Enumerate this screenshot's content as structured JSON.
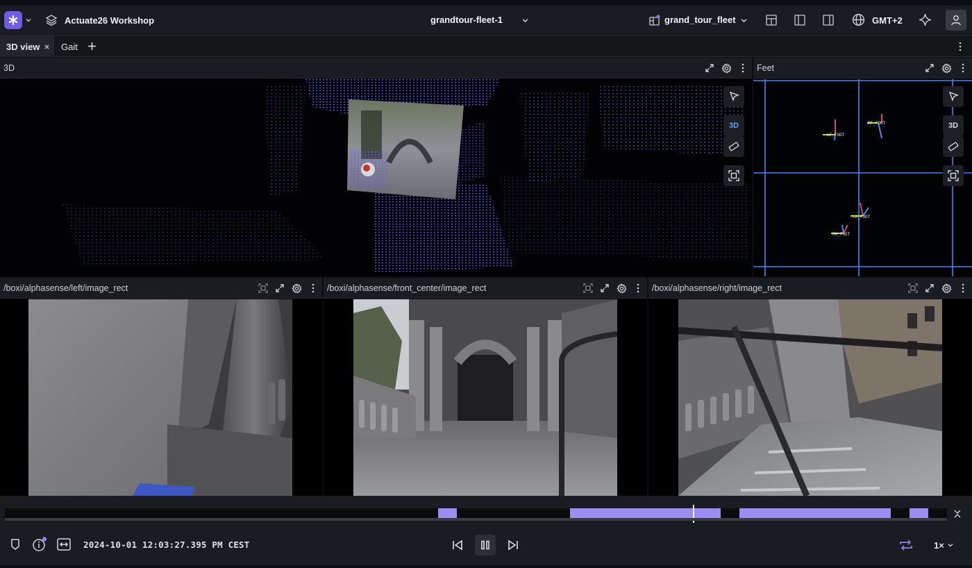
{
  "topbar": {
    "workspace": "Actuate26 Workshop",
    "session": "grandtour-fleet-1",
    "layout": "grand_tour_fleet",
    "timezone": "GMT+2"
  },
  "tabs": [
    {
      "label": "3D view",
      "active": true
    },
    {
      "label": "Gait",
      "active": false
    }
  ],
  "panels": {
    "threed": {
      "title": "3D",
      "view_toggle": "3D"
    },
    "feet": {
      "title": "Feet",
      "view_toggle": "3D",
      "frames": [
        "LF_FOOT",
        "RF_FOOT",
        "LH_FOOT",
        "RH_FOOT"
      ]
    },
    "left_cam": {
      "title": "/boxi/alphasense/left/image_rect"
    },
    "front_cam": {
      "title": "/boxi/alphasense/front_center/image_rect"
    },
    "right_cam": {
      "title": "/boxi/alphasense/right/image_rect"
    }
  },
  "playback": {
    "timestamp": "2024-10-01 12:03:27.395 PM CEST",
    "speed": "1×",
    "progress": 0.73,
    "loaded_ranges": [
      [
        0.46,
        0.48
      ],
      [
        0.6,
        0.76
      ],
      [
        0.78,
        0.94
      ],
      [
        0.96,
        0.98
      ]
    ]
  },
  "colors": {
    "accent": "#6c5ce7",
    "timeline_range": "#9a8cf2",
    "grid": "#3f86ff",
    "toggle_active": "#52a8ff"
  }
}
